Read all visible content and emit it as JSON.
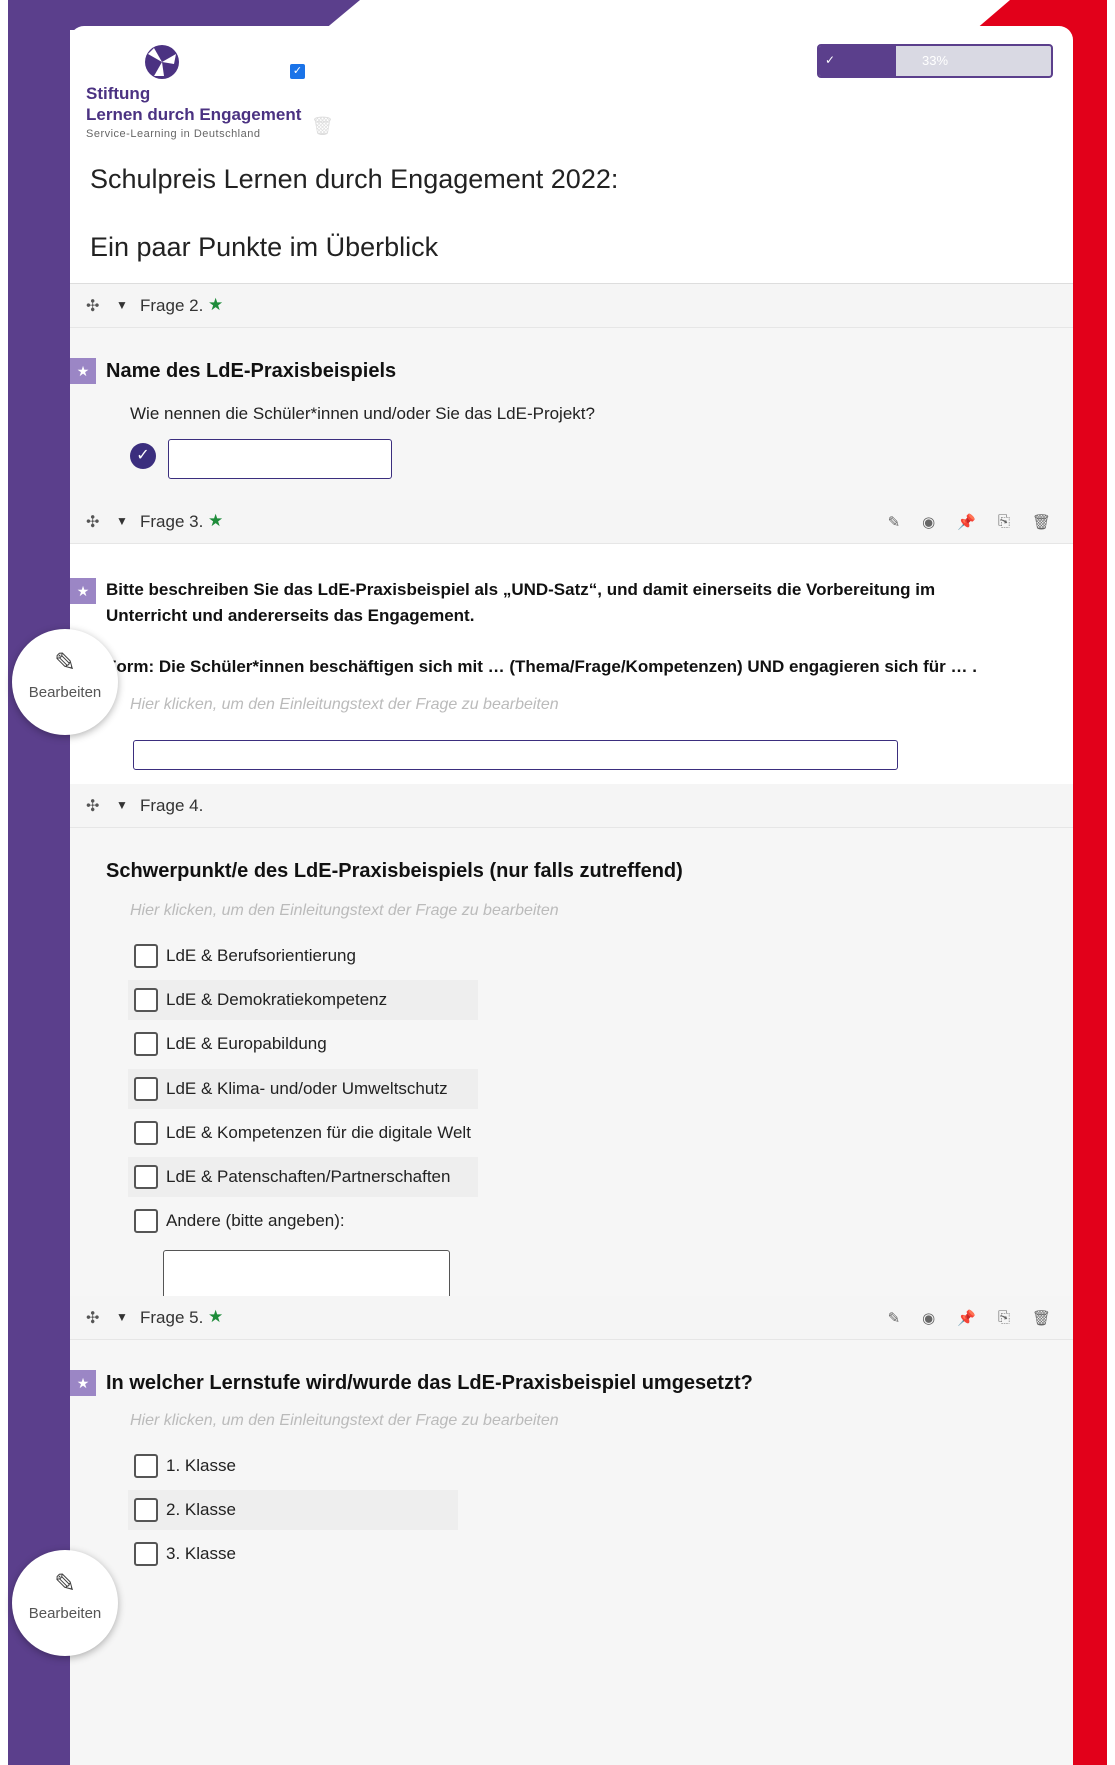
{
  "colors": {
    "brand_purple": "#5b3f8c",
    "brand_red": "#e2001a",
    "required_star": "#1e8c3a"
  },
  "logo": {
    "stiftung": "Stiftung",
    "main": "Lernen durch Engagement",
    "sub": "Service-Learning in Deutschland"
  },
  "progress": {
    "value": 0.33,
    "label": "33%"
  },
  "survey": {
    "title": "Schulpreis Lernen durch Engagement 2022:",
    "subtitle": "Ein paar Punkte im Überblick"
  },
  "icons": {
    "move": "✣",
    "caret": "▼",
    "star": "★",
    "check": "✓",
    "pencil": "✎",
    "eye": "◉",
    "pin": "📌",
    "copy": "⎘",
    "trash": "🗑"
  },
  "questions": [
    {
      "number": "Frage 2.",
      "required": true,
      "title": "Name des LdE-Praxisbeispiels",
      "help": "Wie nennen die Schüler*innen und/oder Sie das LdE-Projekt?"
    },
    {
      "number": "Frage 3.",
      "required": true,
      "title_line1": "Bitte beschreiben Sie das LdE-Praxisbeispiel als „UND-Satz“, und damit einerseits die Vorbereitung im",
      "title_line2": "Unterricht und andererseits das Engagement.",
      "title_line3": "Form: Die Schüler*innen beschäftigen sich mit … (Thema/Frage/Kompetenzen) UND engagieren sich für … .",
      "hint": "Hier klicken, um den Einleitungstext der Frage zu bearbeiten"
    },
    {
      "number": "Frage 4.",
      "required": false,
      "title": "Schwerpunkt/e des LdE-Praxisbeispiels (nur falls zutreffend)",
      "hint": "Hier klicken, um den Einleitungstext der Frage zu bearbeiten",
      "options": [
        "LdE & Berufsorientierung",
        "LdE & Demokratiekompetenz",
        "LdE & Europabildung",
        "LdE & Klima- und/oder Umweltschutz",
        "LdE & Kompetenzen für die digitale Welt",
        "LdE & Patenschaften/Partnerschaften",
        "Andere (bitte angeben):"
      ]
    },
    {
      "number": "Frage 5.",
      "required": true,
      "title": "In welcher Lernstufe wird/wurde das LdE-Praxisbeispiel umgesetzt?",
      "hint": "Hier klicken, um den Einleitungstext der Frage zu bearbeiten",
      "options": [
        "1. Klasse",
        "2. Klasse",
        "3. Klasse"
      ]
    }
  ],
  "edit_bubble": {
    "label": "Bearbeiten"
  }
}
